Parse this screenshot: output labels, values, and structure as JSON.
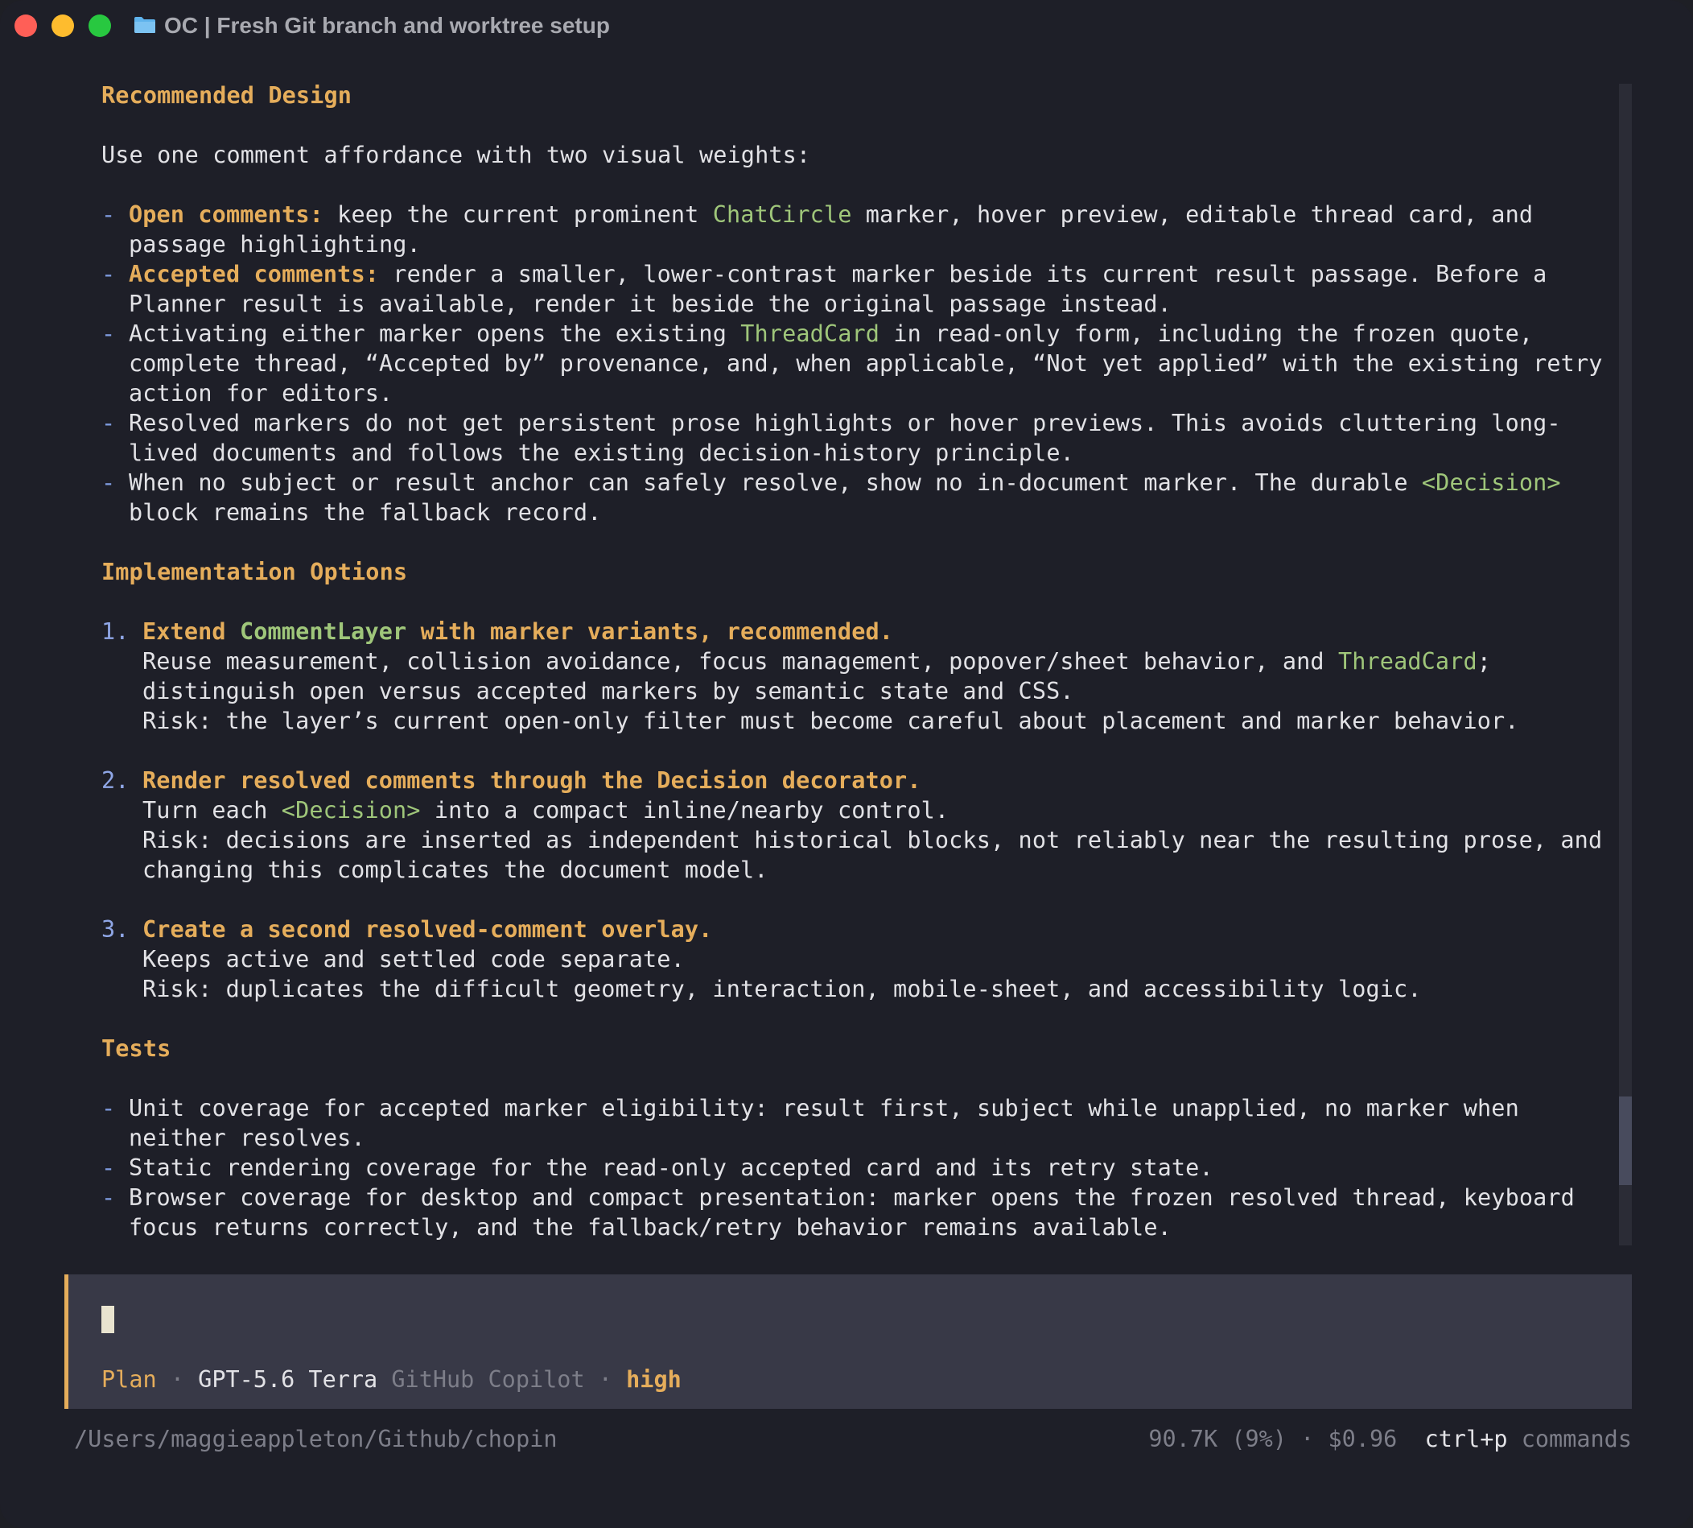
{
  "window": {
    "title": "OC | Fresh Git branch and worktree setup",
    "icons": [
      "close-light",
      "minimize-light",
      "zoom-light",
      "folder-icon"
    ]
  },
  "doc": {
    "h_design": "Recommended Design",
    "intro": "Use one comment affordance with two visual weights:",
    "bullets": {
      "b1_label": "Open comments:",
      "b1_t1": " keep the current prominent ",
      "b1_code": "ChatCircle",
      "b1_t2": " marker, hover preview, editable thread card, and",
      "b1_l2": "passage highlighting.",
      "b2_label": "Accepted comments:",
      "b2_t1": " render a smaller, lower-contrast marker beside its current result passage. Before a",
      "b2_l2": "Planner result is available, render it beside the original passage instead.",
      "b3_t1": "Activating either marker opens the existing ",
      "b3_code": "ThreadCard",
      "b3_t2": " in read-only form, including the frozen quote,",
      "b3_l2": "complete thread, “Accepted by” provenance, and, when applicable, “Not yet applied” with the existing retry",
      "b3_l3": "action for editors.",
      "b4_l1": "Resolved markers do not get persistent prose highlights or hover previews. This avoids cluttering long-",
      "b4_l2": "lived documents and follows the existing decision-history principle.",
      "b5_t1": "When no subject or result anchor can safely resolve, show no in-document marker. The durable ",
      "b5_code": "<Decision>",
      "b5_l2": "block remains the fallback record."
    },
    "h_impl": "Implementation Options",
    "options": {
      "o1_num": "1.",
      "o1_t1": "Extend ",
      "o1_code": "CommentLayer",
      "o1_t2": " with marker variants, recommended.",
      "o1_l2a": "Reuse measurement, collision avoidance, focus management, popover/sheet behavior, and ",
      "o1_l2code": "ThreadCard",
      "o1_l2b": ";",
      "o1_l3": "distinguish open versus accepted markers by semantic state and CSS.",
      "o1_l4": "Risk: the layer’s current open-only filter must become careful about placement and marker behavior.",
      "o2_num": "2.",
      "o2_title": "Render resolved comments through the Decision decorator.",
      "o2_l2a": "Turn each ",
      "o2_l2code": "<Decision>",
      "o2_l2b": " into a compact inline/nearby control.",
      "o2_l3": "Risk: decisions are inserted as independent historical blocks, not reliably near the resulting prose, and",
      "o2_l4": "changing this complicates the document model.",
      "o3_num": "3.",
      "o3_title": "Create a second resolved-comment overlay.",
      "o3_l2": "Keeps active and settled code separate.",
      "o3_l3": "Risk: duplicates the difficult geometry, interaction, mobile-sheet, and accessibility logic."
    },
    "h_tests": "Tests",
    "tests": {
      "t1_l1": "Unit coverage for accepted marker eligibility: result first, subject while unapplied, no marker when",
      "t1_l2": "neither resolves.",
      "t2_l1": "Static rendering coverage for the read-only accepted card and its retry state.",
      "t3_l1": "Browser coverage for desktop and compact presentation: marker opens the frozen resolved thread, keyboard",
      "t3_l2": "focus returns correctly, and the fallback/retry behavior remains available."
    }
  },
  "prompt": {
    "mode": "Plan",
    "sep": "·",
    "model": "GPT-5.6 Terra",
    "provider": "GitHub Copilot",
    "effort": "high"
  },
  "footer": {
    "path": "/Users/maggieappleton/Github/chopin",
    "tokens": "90.7K (9%)",
    "cost": "$0.96",
    "key": "ctrl+p",
    "key_label": "commands"
  }
}
